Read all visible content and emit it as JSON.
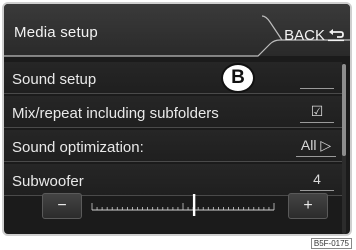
{
  "header": {
    "title": "Media setup",
    "back_label": "BACK"
  },
  "menu": {
    "items": [
      {
        "label": "Sound setup",
        "value": ""
      },
      {
        "label": "Mix/repeat including subfolders",
        "value": "☑"
      },
      {
        "label": "Sound optimization:",
        "value": "All ▷"
      },
      {
        "label": "Subwoofer",
        "value": "4"
      }
    ]
  },
  "callout": {
    "label": "B"
  },
  "subwoofer_slider": {
    "minus_label": "−",
    "plus_label": "+",
    "level_fraction": 0.56
  },
  "scrollbar": {
    "position_fraction": 0.0,
    "visible_fraction": 0.54
  },
  "footer": {
    "code": "B5F-0175"
  },
  "colors": {
    "screen_bg": "#1b1b1b",
    "text": "#e9e9e9",
    "badge_bg": "#ffffff"
  }
}
